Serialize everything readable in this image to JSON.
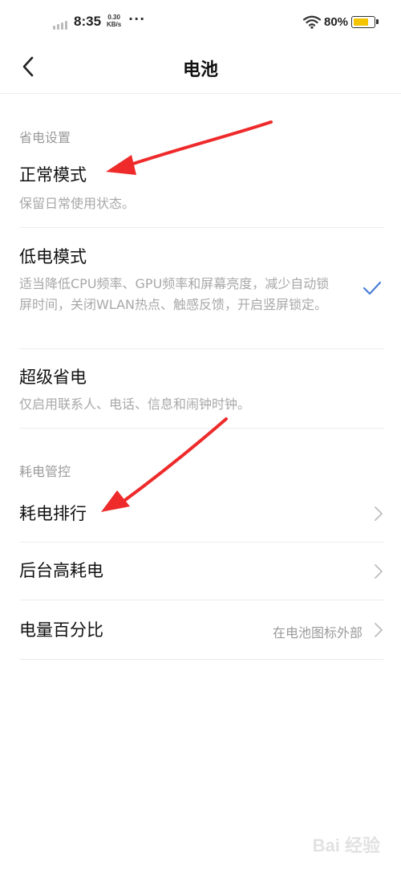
{
  "status_bar": {
    "time": "8:35",
    "net_speed_value": "0.30",
    "net_speed_unit": "KB/s",
    "more": "···",
    "battery_percent": "80%",
    "battery_level": 0.8,
    "battery_color": "#f5c400"
  },
  "header": {
    "title": "电池",
    "back_icon": "chevron-left-icon"
  },
  "power_saving": {
    "label": "省电设置",
    "items": [
      {
        "title": "正常模式",
        "desc": "保留日常使用状态。",
        "checked": false
      },
      {
        "title": "低电模式",
        "desc": "适当降低CPU频率、GPU频率和屏幕亮度，减少自动锁屏时间，关闭WLAN热点、触感反馈，开启竖屏锁定。",
        "checked": true
      },
      {
        "title": "超级省电",
        "desc": "仅启用联系人、电话、信息和闹钟时钟。",
        "checked": false
      }
    ]
  },
  "power_control": {
    "label": "耗电管控",
    "items": [
      {
        "title": "耗电排行",
        "value": ""
      },
      {
        "title": "后台高耗电",
        "value": ""
      },
      {
        "title": "电量百分比",
        "value": "在电池图标外部"
      }
    ]
  },
  "colors": {
    "check": "#4a7fd6",
    "annotation_arrow": "#ee2a2a"
  },
  "watermark": "Bai 经验"
}
